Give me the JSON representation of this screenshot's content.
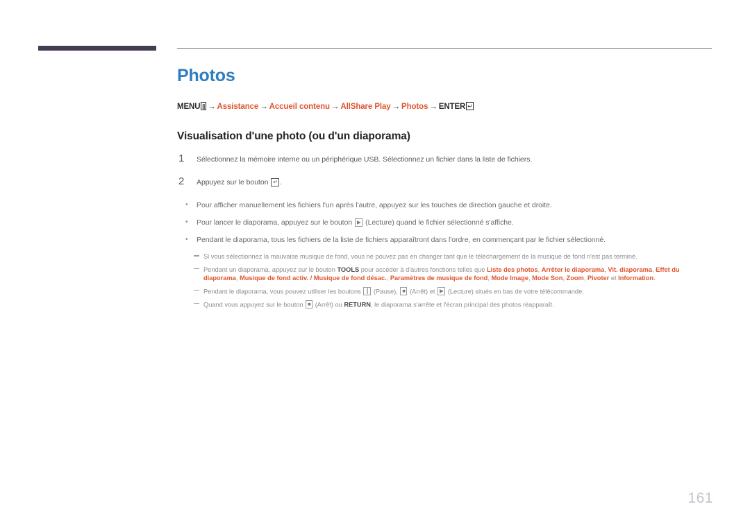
{
  "page": {
    "title": "Photos",
    "number": "161"
  },
  "path": {
    "menu_label": "MENU",
    "menu_icon": "menu-grid-icon",
    "enter_label": "ENTER",
    "enter_icon": "enter-return-icon",
    "arrow": "→",
    "crumbs": [
      "Assistance",
      "Accueil contenu",
      "AllShare Play",
      "Photos"
    ]
  },
  "section": {
    "heading": "Visualisation d'une photo (ou d'un diaporama)"
  },
  "steps": [
    {
      "num": "1",
      "text": "Sélectionnez la mémoire interne ou un périphérique USB. Sélectionnez un fichier dans la liste de fichiers."
    },
    {
      "num": "2",
      "text_before": "Appuyez sur le bouton ",
      "glyph": "enter-return-icon",
      "text_after": "."
    }
  ],
  "bullets": [
    {
      "marker": "•",
      "text": "Pour afficher manuellement les fichiers l'un après l'autre, appuyez sur les touches de direction gauche et droite."
    },
    {
      "marker": "•",
      "text_before": "Pour lancer le diaporama, appuyez sur le bouton ",
      "glyph": "play-icon",
      "text_after": " (Lecture) quand le fichier sélectionné s'affiche."
    },
    {
      "marker": "•",
      "text": "Pendant le diaporama, tous les fichiers de la liste de fichiers apparaîtront dans l'ordre, en commençant par le fichier sélectionné."
    }
  ],
  "notes": [
    {
      "text": "Si vous sélectionnez la mauvaise musique de fond, vous ne pouvez pas en changer tant que le téléchargement de la musique de fond n'est pas terminé."
    },
    {
      "text_before": "Pendant un diaporama, appuyez sur le bouton ",
      "bold_key": "TOOLS",
      "text_mid": " pour accéder à d'autres fonctions telles que ",
      "options": [
        "Liste des photos",
        "Arrêter le diaporama",
        "Vit. diaporama",
        "Effet du diaporama",
        "Musique de fond activ. / Musique de fond désac.",
        "Paramètres de musique de fond",
        "Mode Image",
        "Mode Son",
        "Zoom",
        "Pivoter"
      ],
      "conjunction": " et ",
      "last_option": "Information",
      "text_end": "."
    },
    {
      "text_before": "Pendant le diaporama, vous pouvez utiliser les boutons ",
      "glyph_pause": "pause-icon",
      "label_pause": " (Pause), ",
      "glyph_stop": "stop-icon",
      "label_stop": " (Arrêt) et ",
      "glyph_play": "play-icon",
      "label_play": " (Lecture) situés en bas de votre télécommande."
    },
    {
      "text_before": "Quand vous appuyez sur le bouton ",
      "glyph_stop": "stop-icon",
      "text_mid": " (Arrêt) ou ",
      "bold_key": "RETURN",
      "text_after": ", le diaporama s'arrête et l'écran principal des photos réapparaît."
    }
  ],
  "colors": {
    "title_blue": "#2f7cc0",
    "accent_orange": "#e0542e",
    "header_bar": "#453c52",
    "body_text": "#59595e",
    "note_text": "#8c8c92",
    "page_number": "#c3c3cb"
  }
}
